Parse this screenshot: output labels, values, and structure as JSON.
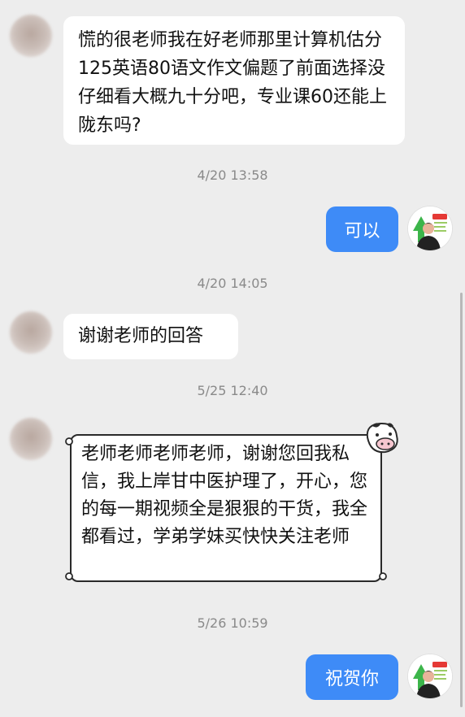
{
  "messages": [
    {
      "text": "慌的很老师我在好老师那里计算机估分125英语80语文作文偏题了前面选择没仔细看大概九十分吧，专业课60还能上陇东吗?"
    },
    {
      "time": "4/20 13:58"
    },
    {
      "text": "可以"
    },
    {
      "time": "4/20 14:05"
    },
    {
      "text": "谢谢老师的回答"
    },
    {
      "time": "5/25 12:40"
    },
    {
      "text": "老师老师老师老师，谢谢您回我私信，我上岸甘中医护理了，开心，您的每一期视频全是狠狠的干货，我全都看过，学弟学妹买快快关注老师"
    },
    {
      "time": "5/26 10:59"
    },
    {
      "text": "祝贺你"
    }
  ],
  "colors": {
    "background": "#ededed",
    "outgoing_bubble": "#3e8bf7",
    "incoming_bubble": "#ffffff",
    "timestamp": "#8a8a8a"
  },
  "icons": {
    "student_avatar": "blurred-avatar",
    "teacher_avatar": "teacher-avatar-with-green-arrow"
  }
}
